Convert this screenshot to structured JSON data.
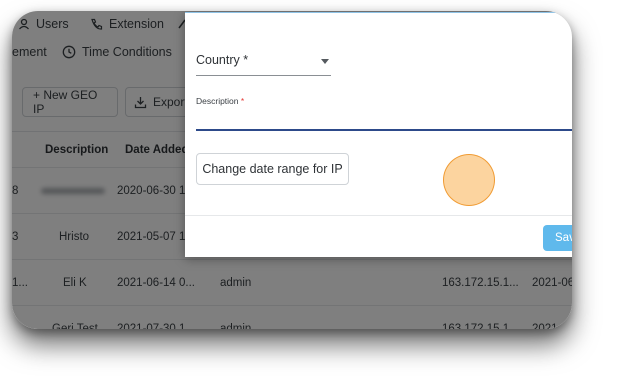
{
  "navbar": {
    "users_label": "Users",
    "extension_label": "Extension"
  },
  "subbar": {
    "management_label": "ement",
    "time_conditions_label": "Time Conditions"
  },
  "toolbar": {
    "new_geo_ip_label": "+ New GEO IP",
    "export_label": "Export"
  },
  "table": {
    "headers": [
      "Description",
      "Date Added"
    ],
    "rows": [
      {
        "prefix": "8",
        "description": "",
        "date_added": "2020-06-30 1...",
        "added_by": "",
        "ip": "",
        "date2": ""
      },
      {
        "prefix": "3",
        "description": "Hristo",
        "date_added": "2021-05-07 1...",
        "added_by": "",
        "ip": "",
        "date2": ""
      },
      {
        "prefix": "1...",
        "description": "Eli K",
        "date_added": "2021-06-14 0...",
        "added_by": "admin",
        "ip": "163.172.15.1...",
        "date2": "2021-06"
      },
      {
        "prefix": "1...",
        "description": "Geri Test",
        "date_added": "2021-07-30 1...",
        "added_by": "admin",
        "ip": "163.172.15.1...",
        "date2": "2021-0"
      }
    ]
  },
  "modal": {
    "country_label": "Country *",
    "description_label": "Description",
    "required_mark": "*",
    "description_value": "",
    "change_range_label": "Change date range for IP",
    "save_label": "Sav"
  },
  "colors": {
    "overlay": "#000000",
    "input_focus": "#2d4a8a",
    "save_button": "#5fb9ec",
    "click_indicator": "#fab050",
    "required": "#e53935"
  }
}
